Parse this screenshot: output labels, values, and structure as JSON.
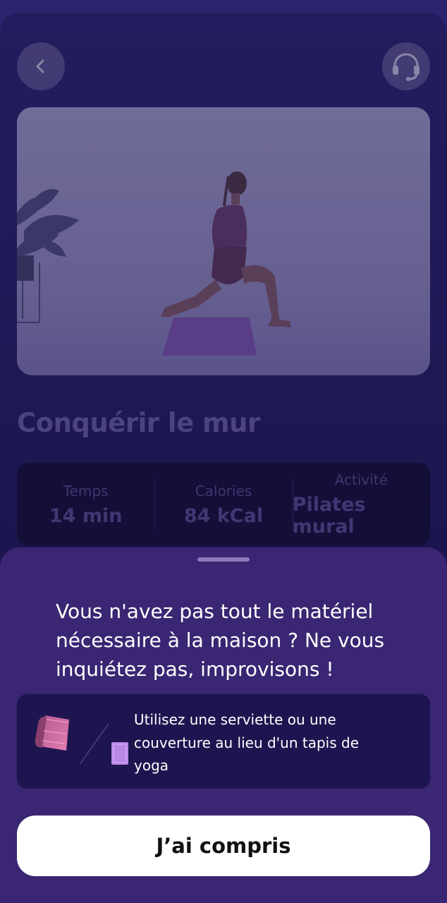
{
  "colors": {
    "background": "#221b5b",
    "sheet": "#3a2673",
    "tip_card": "#1e1550",
    "button_bg": "#ffffff",
    "button_text": "#111111"
  },
  "header": {
    "back_icon": "chevron-left-icon",
    "support_icon": "headset-icon"
  },
  "workout": {
    "title": "Conquérir le mur",
    "stats": [
      {
        "label": "Temps",
        "value": "14 min"
      },
      {
        "label": "Calories",
        "value": "84 kCal"
      },
      {
        "label": "Activité",
        "value": "Pilates mural"
      }
    ]
  },
  "sheet": {
    "heading": "Vous n'avez pas tout le matériel nécessaire à la maison ? Ne vous inquiétez pas, improvisons !",
    "tip": {
      "icon": "yoga-mat-towel-icon",
      "text": "Utilisez une serviette ou une couverture au lieu d'un tapis de yoga"
    },
    "confirm_label": "J’ai compris"
  }
}
